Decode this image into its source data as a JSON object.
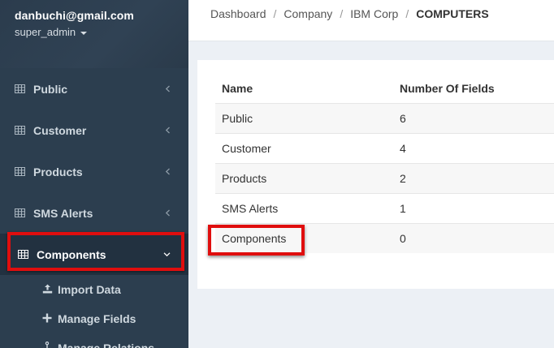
{
  "user": {
    "email": "danbuchi@gmail.com",
    "role": "super_admin"
  },
  "sidebar": {
    "items": [
      {
        "label": "Public",
        "icon": "table-icon",
        "expanded": false
      },
      {
        "label": "Customer",
        "icon": "table-icon",
        "expanded": false
      },
      {
        "label": "Products",
        "icon": "table-icon",
        "expanded": false
      },
      {
        "label": "SMS Alerts",
        "icon": "table-icon",
        "expanded": false
      },
      {
        "label": "Components",
        "icon": "table-icon",
        "expanded": true
      }
    ],
    "subitems": [
      {
        "label": "Import Data",
        "icon": "upload-icon"
      },
      {
        "label": "Manage Fields",
        "icon": "plus-icon"
      },
      {
        "label": "Manage Relations",
        "icon": "anchor-icon"
      }
    ]
  },
  "breadcrumb": {
    "items": [
      "Dashboard",
      "Company",
      "IBM Corp"
    ],
    "current": "COMPUTERS",
    "separator": "/"
  },
  "table": {
    "headers": [
      "Name",
      "Number Of Fields"
    ],
    "rows": [
      {
        "name": "Public",
        "fields": "6"
      },
      {
        "name": "Customer",
        "fields": "4"
      },
      {
        "name": "Products",
        "fields": "2"
      },
      {
        "name": "SMS Alerts",
        "fields": "1"
      },
      {
        "name": "Components",
        "fields": "0"
      }
    ]
  },
  "colors": {
    "sidebar_bg": "#2c3e4f",
    "highlight": "#e00e0e",
    "content_bg": "#ecf0f5"
  }
}
